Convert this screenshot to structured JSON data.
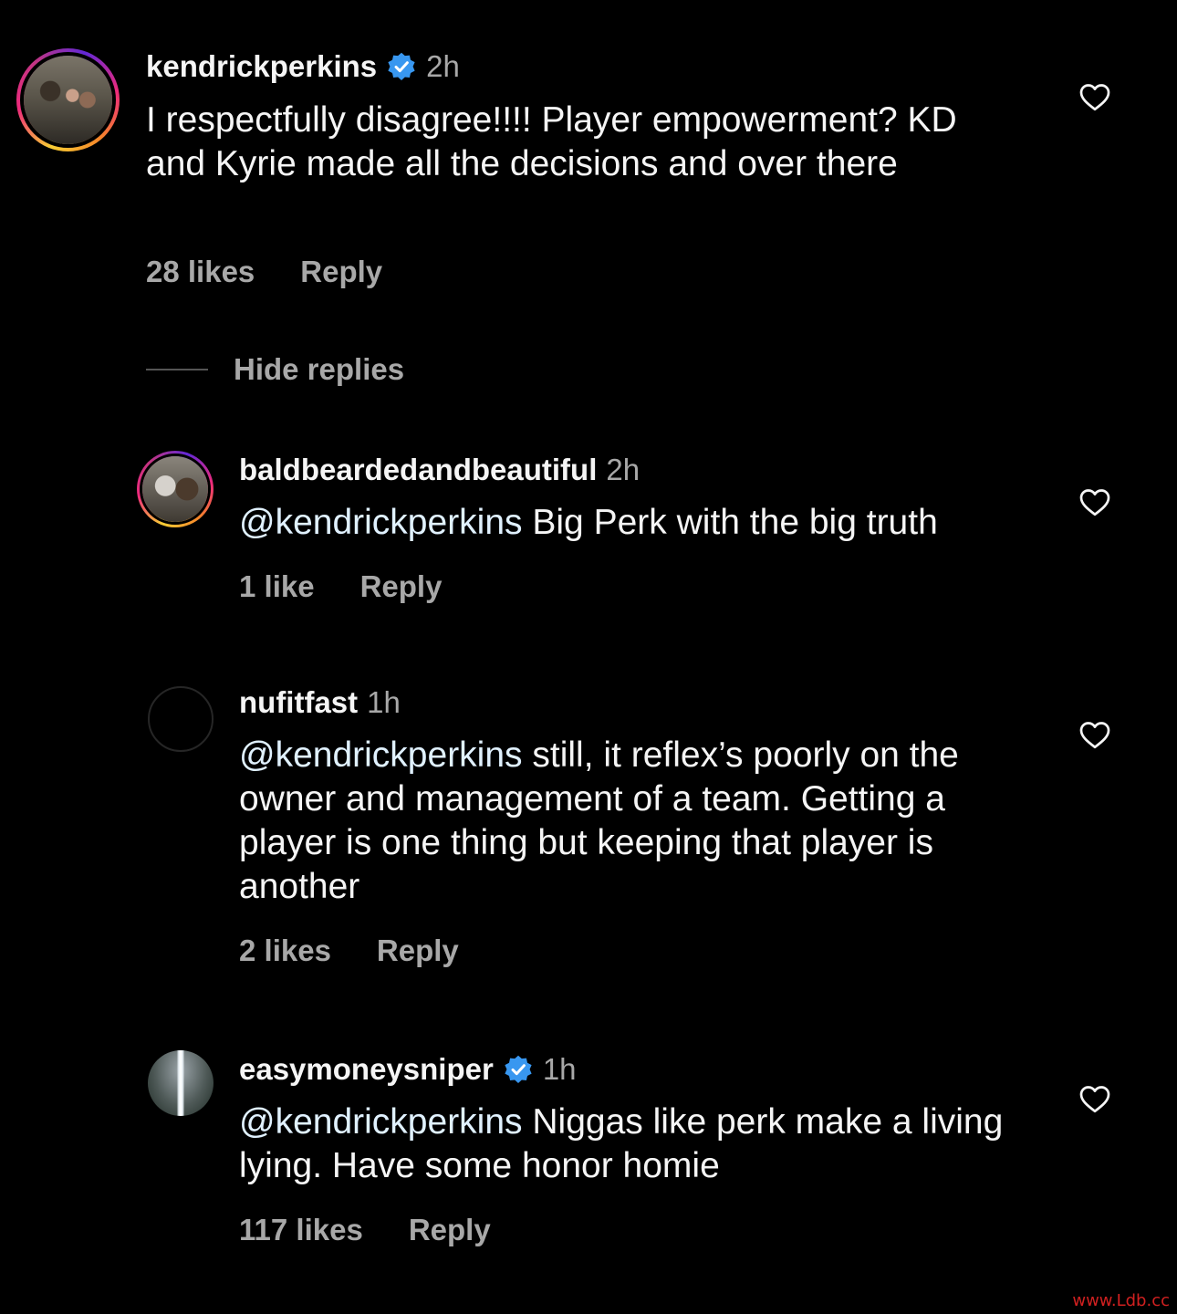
{
  "comments": [
    {
      "username": "kendrickperkins",
      "verified": true,
      "time": "2h",
      "mention": "",
      "text": "I respectfully disagree!!!! Player empowerment? KD and Kyrie made all the decisions and over there",
      "likes": "28 likes",
      "reply_label": "Reply",
      "avatar_has_story": true
    },
    {
      "username": "baldbeardedandbeautiful",
      "verified": false,
      "time": "2h",
      "mention": "@kendrickperkins",
      "text": " Big Perk with the big truth",
      "likes": "1 like",
      "reply_label": "Reply",
      "avatar_has_story": true
    },
    {
      "username": "nufitfast",
      "verified": false,
      "time": "1h",
      "mention": "@kendrickperkins",
      "text": " still, it reflex’s poorly on the owner and management of a team. Getting a player is one thing but keeping that player is another",
      "likes": "2 likes",
      "reply_label": "Reply",
      "avatar_has_story": false
    },
    {
      "username": "easymoneysniper",
      "verified": true,
      "time": "1h",
      "mention": "@kendrickperkins",
      "text": " Niggas like perk make a living lying. Have some honor homie",
      "likes": "117 likes",
      "reply_label": "Reply",
      "avatar_has_story": false
    }
  ],
  "hide_replies_label": "Hide replies",
  "watermark": "www.Ldb.cc",
  "colors": {
    "background": "#000000",
    "primary_text": "#f5f5f5",
    "secondary_text": "#a8a8a8",
    "verified_blue": "#3897f0",
    "mention": "#e0f1ff"
  }
}
